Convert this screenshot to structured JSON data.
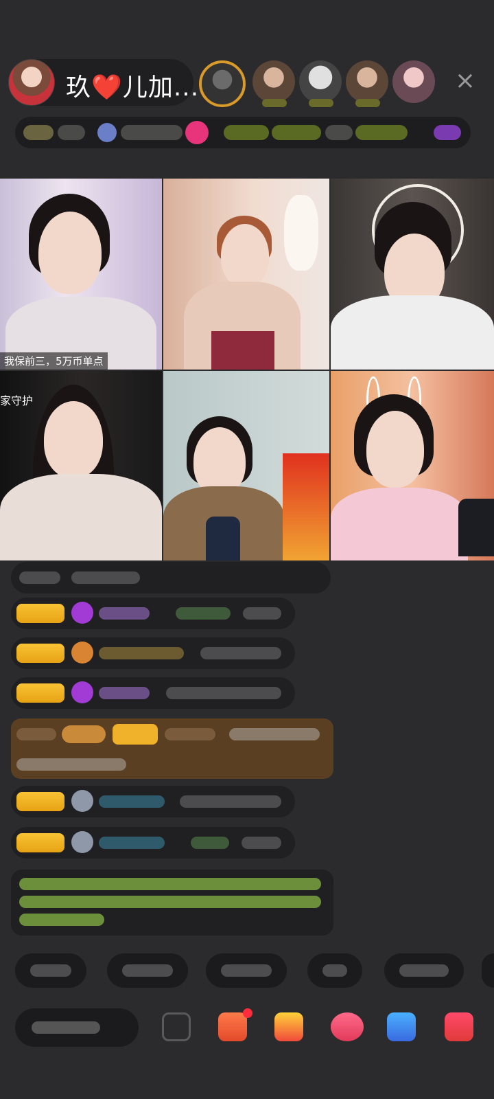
{
  "header": {
    "host_name_prefix": "玖",
    "host_name_heart": "❤️",
    "host_name_suffix": "儿加...",
    "close_label": "×"
  },
  "grid": {
    "tiles": [
      {
        "caption": "我保前三，5万币单点"
      },
      {},
      {},
      {
        "side_label": "家守护"
      },
      {
        "top_label": ""
      },
      {}
    ]
  },
  "colors": {
    "background": "#2b2b2d",
    "badge_gold": "#f2b62a",
    "gem_purple": "#a23bd6",
    "system_brown": "#5a3f22",
    "notice_green": "#6c8f3c",
    "heart_red": "#ff2b3c"
  },
  "icons": {
    "close": "close-icon",
    "message": "message-icon",
    "gift_box": "gift-box-icon",
    "gift": "gift-icon",
    "lips": "lips-icon",
    "share": "share-icon",
    "more": "more-icon"
  }
}
